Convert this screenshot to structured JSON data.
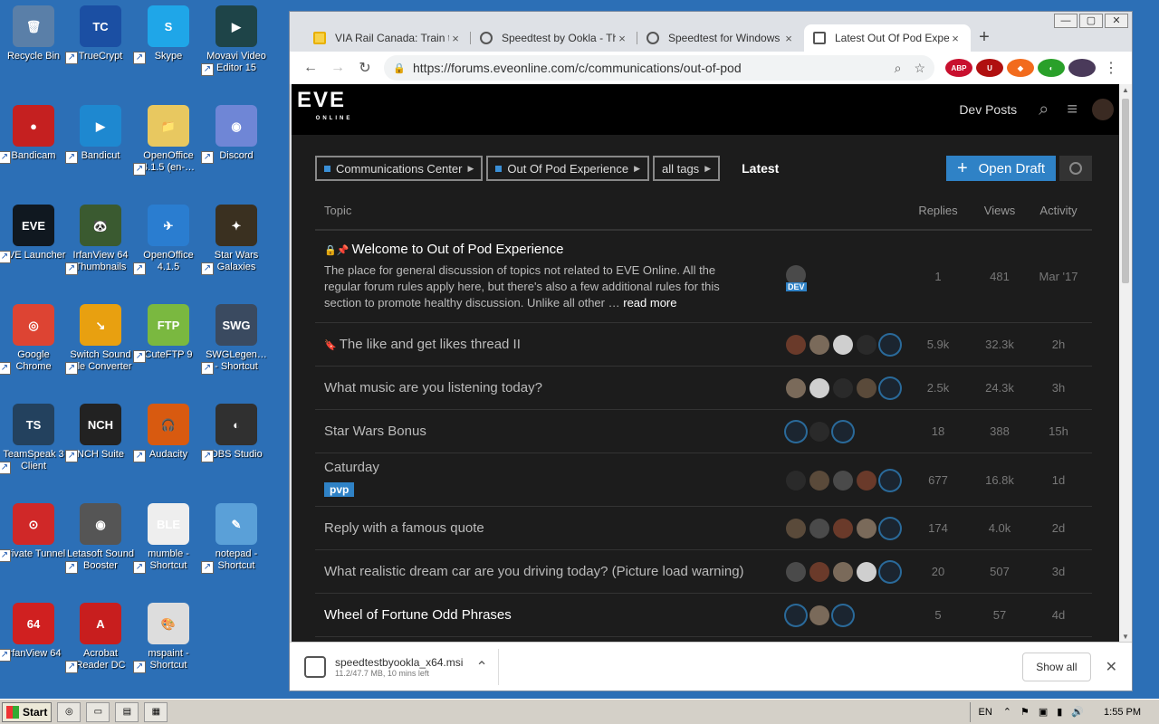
{
  "desktop": {
    "icons": [
      {
        "label": "Recycle Bin",
        "glyph": "🗑",
        "color": "#5a7fa8"
      },
      {
        "label": "TrueCrypt",
        "glyph": "TC",
        "color": "#1b4fa3"
      },
      {
        "label": "Skype",
        "glyph": "S",
        "color": "#1fa6e8"
      },
      {
        "label": "Movavi Video Editor 15",
        "glyph": "▶",
        "color": "#1e4448"
      },
      {
        "label": "Bandicam",
        "glyph": "●",
        "color": "#c52020"
      },
      {
        "label": "Bandicut",
        "glyph": "▶",
        "color": "#1e88d0"
      },
      {
        "label": "OpenOffice 4.1.5 (en-…",
        "glyph": "📁",
        "color": "#e8c860"
      },
      {
        "label": "Discord",
        "glyph": "◉",
        "color": "#6f86d6"
      },
      {
        "label": "EVE Launcher",
        "glyph": "EVE",
        "color": "#101820"
      },
      {
        "label": "IrfanView 64 Thumbnails",
        "glyph": "🐼",
        "color": "#3a5a30"
      },
      {
        "label": "OpenOffice 4.1.5",
        "glyph": "✈",
        "color": "#2a7dd0"
      },
      {
        "label": "Star Wars Galaxies",
        "glyph": "✦",
        "color": "#3a3020"
      },
      {
        "label": "Google Chrome",
        "glyph": "◎",
        "color": "#dd4433"
      },
      {
        "label": "Switch Sound File Converter",
        "glyph": "↘",
        "color": "#e8a010"
      },
      {
        "label": "CuteFTP 9",
        "glyph": "FTP",
        "color": "#7ab840"
      },
      {
        "label": "SWGLegen… - Shortcut",
        "glyph": "SWG",
        "color": "#3a4a60"
      },
      {
        "label": "TeamSpeak 3 Client",
        "glyph": "TS",
        "color": "#23415e"
      },
      {
        "label": "NCH Suite",
        "glyph": "NCH",
        "color": "#222222"
      },
      {
        "label": "Audacity",
        "glyph": "🎧",
        "color": "#d85a10"
      },
      {
        "label": "OBS Studio",
        "glyph": "◐",
        "color": "#303030"
      },
      {
        "label": "Private Tunnel",
        "glyph": "⊙",
        "color": "#d02828"
      },
      {
        "label": "Letasoft Sound Booster",
        "glyph": "◉",
        "color": "#555555"
      },
      {
        "label": "mumble - Shortcut",
        "glyph": "BLE",
        "color": "#eeeeee"
      },
      {
        "label": "notepad - Shortcut",
        "glyph": "✎",
        "color": "#5aa0d8"
      },
      {
        "label": "IrfanView 64",
        "glyph": "64",
        "color": "#d02020"
      },
      {
        "label": "Acrobat Reader DC",
        "glyph": "A",
        "color": "#c81e1e"
      },
      {
        "label": "mspaint - Shortcut",
        "glyph": "🎨",
        "color": "#dddddd"
      }
    ]
  },
  "browser": {
    "tabs": [
      {
        "title": "VIA Rail Canada: Train tr…",
        "close": "×"
      },
      {
        "title": "Speedtest by Ookla - The",
        "close": "×"
      },
      {
        "title": "Speedtest for Windows -",
        "close": "×"
      },
      {
        "title": "Latest Out Of Pod Experie",
        "close": "×"
      }
    ],
    "new_tab": "+",
    "url": "https://forums.eveonline.com/c/communications/out-of-pod",
    "window_controls": [
      "—",
      "▢",
      "✕"
    ]
  },
  "forum": {
    "logo": "EVE",
    "logo_sub": "ONLINE",
    "dev_posts": "Dev Posts",
    "breadcrumbs": [
      "Communications Center",
      "Out Of Pod Experience",
      "all tags"
    ],
    "latest": "Latest",
    "open_draft": "Open Draft",
    "columns": {
      "topic": "Topic",
      "replies": "Replies",
      "views": "Views",
      "activity": "Activity"
    },
    "topics": [
      {
        "title": "Welcome to Out of Pod Experience",
        "pinned": true,
        "excerpt": "The place for general discussion of topics not related to EVE Online. All the regular forum rules apply here, but there's also a few additional rules for this section to promote healthy discussion. Unlike all other …",
        "read_more": "read more",
        "replies": "1",
        "views": "481",
        "activity": "Mar '17",
        "badge": "DEV",
        "avatars": 1
      },
      {
        "title": "The like and get likes thread II",
        "bookmark": true,
        "replies": "5.9k",
        "views": "32.3k",
        "activity": "2h",
        "avatars": 5
      },
      {
        "title": "What music are you listening today?",
        "replies": "2.5k",
        "views": "24.3k",
        "activity": "3h",
        "avatars": 5
      },
      {
        "title": "Star Wars Bonus",
        "replies": "18",
        "views": "388",
        "activity": "15h",
        "avatars": 3
      },
      {
        "title": "Caturday",
        "tag": "pvp",
        "replies": "677",
        "views": "16.8k",
        "activity": "1d",
        "avatars": 5
      },
      {
        "title": "Reply with a famous quote",
        "replies": "174",
        "views": "4.0k",
        "activity": "2d",
        "avatars": 5
      },
      {
        "title": "What realistic dream car are you driving today? (Picture load warning)",
        "replies": "20",
        "views": "507",
        "activity": "3d",
        "avatars": 5
      },
      {
        "title": "Wheel of Fortune Odd Phrases",
        "replies": "5",
        "views": "57",
        "activity": "4d",
        "avatars": 3,
        "bold": true
      }
    ]
  },
  "download": {
    "filename": "speedtestbyookla_x64.msi",
    "status": "11.2/47.7 MB, 10 mins left",
    "show_all": "Show all"
  },
  "taskbar": {
    "start": "Start",
    "lang": "EN",
    "time": "1:55 PM"
  }
}
